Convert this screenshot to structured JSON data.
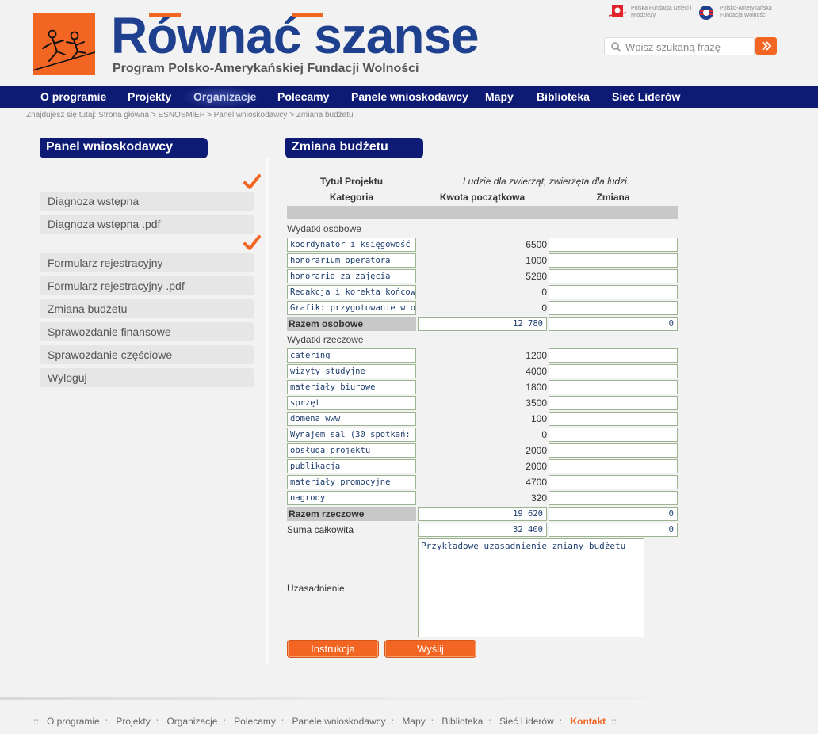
{
  "header": {
    "title": "Równać szanse",
    "subtitle": "Program Polsko-Amerykańskiej Fundacji Wolności",
    "partner1": "Polska Fundacja Dzieci i Młodzieży",
    "partner2": "Polsko-Amerykańska Fundacja Wolności",
    "search_placeholder": "Wpisz szukaną frazę"
  },
  "nav": [
    "O programie",
    "Projekty",
    "Organizacje",
    "Polecamy",
    "Panele wnioskodawcy",
    "Mapy",
    "Biblioteka",
    "Sieć Liderów"
  ],
  "breadcrumb": "Znajdujesz się tutaj:   Strona główna > ESNOSMiEP > Panel wnioskodawcy > Zmiana budżetu",
  "sidebar": {
    "title": "Panel wnioskodawcy",
    "items": [
      "Diagnoza wstępna",
      "Diagnoza wstępna .pdf",
      "Formularz rejestracyjny",
      "Formularz rejestracyjny .pdf",
      "Zmiana budżetu",
      "Sprawozdanie finansowe",
      "Sprawozdanie częściowe",
      "Wyloguj"
    ]
  },
  "main": {
    "title": "Zmiana budżetu",
    "project_label": "Tytuł Projektu",
    "project_title": "Ludzie dla zwierząt, zwierzęta dla ludzi.",
    "col_category": "Kategoria",
    "col_initial": "Kwota początkowa",
    "col_change": "Zmiana",
    "section_personal": "Wydatki osobowe",
    "personal": [
      {
        "name": "koordynator i księgowość",
        "amount": "6500"
      },
      {
        "name": "honorarium operatora",
        "amount": "1000"
      },
      {
        "name": "honoraria za zajęcia",
        "amount": "5280"
      },
      {
        "name": "Redakcja i korekta końcow",
        "amount": "0"
      },
      {
        "name": "Grafik: przygotowanie w op",
        "amount": "0"
      }
    ],
    "personal_total_label": "Razem osobowe",
    "personal_total": "12 780",
    "personal_change": "0",
    "section_material": "Wydatki rzeczowe",
    "material": [
      {
        "name": "catering",
        "amount": "1200"
      },
      {
        "name": "wizyty studyjne",
        "amount": "4000"
      },
      {
        "name": "materiały biurowe",
        "amount": "1800"
      },
      {
        "name": "sprzęt",
        "amount": "3500"
      },
      {
        "name": "domena www",
        "amount": "100"
      },
      {
        "name": "Wynajem sal (30 spotkań:",
        "amount": "0"
      },
      {
        "name": "obsługa projektu",
        "amount": "2000"
      },
      {
        "name": "publikacja",
        "amount": "2000"
      },
      {
        "name": "materiały promocyjne",
        "amount": "4700"
      },
      {
        "name": "nagrody",
        "amount": "320"
      }
    ],
    "material_total_label": "Razem rzeczowe",
    "material_total": "19 620",
    "material_change": "0",
    "grand_total_label": "Suma całkowita",
    "grand_total": "32 400",
    "grand_change": "0",
    "justification_label": "Uzasadnienie",
    "justification_text": "Przykładowe uzasadnienie zmiany budżetu",
    "btn_instruction": "Instrukcja",
    "btn_send": "Wyślij"
  },
  "footer": [
    "O programie",
    "Projekty",
    "Organizacje",
    "Polecamy",
    "Panele wnioskodawcy",
    "Mapy",
    "Biblioteka",
    "Sieć Liderów",
    "Kontakt"
  ],
  "colors": {
    "accent": "#f26522",
    "nav": "#0e1b74",
    "brand": "#1f3f8f"
  }
}
